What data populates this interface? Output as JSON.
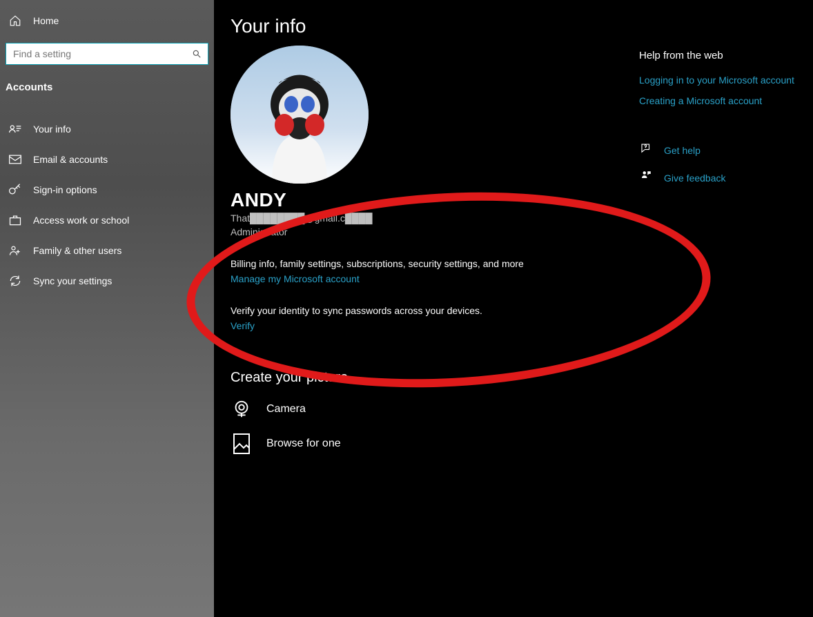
{
  "sidebar": {
    "home": "Home",
    "search_placeholder": "Find a setting",
    "section": "Accounts",
    "items": [
      {
        "label": "Your info"
      },
      {
        "label": "Email & accounts"
      },
      {
        "label": "Sign-in options"
      },
      {
        "label": "Access work or school"
      },
      {
        "label": "Family & other users"
      },
      {
        "label": "Sync your settings"
      }
    ]
  },
  "main": {
    "title": "Your info",
    "username": "ANDY",
    "email_redacted": "That████████@gmail.c████",
    "role": "Administrator",
    "billing_text": "Billing info, family settings, subscriptions, security settings, and more",
    "manage_link": "Manage my Microsoft account",
    "verify_text": "Verify your identity to sync passwords across your devices.",
    "verify_link": "Verify",
    "create_picture": "Create your picture",
    "camera": "Camera",
    "browse": "Browse for one"
  },
  "right": {
    "help_title": "Help from the web",
    "links": [
      "Logging in to your Microsoft account",
      "Creating a Microsoft account"
    ],
    "get_help": "Get help",
    "feedback": "Give feedback"
  }
}
